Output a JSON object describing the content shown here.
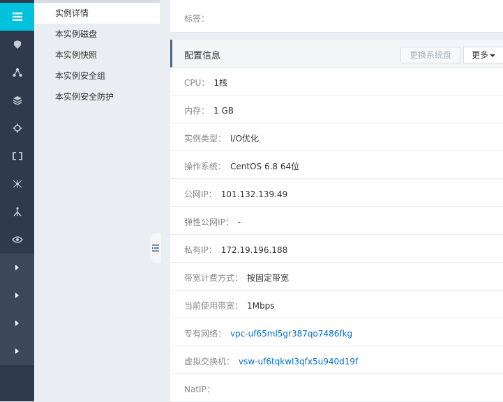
{
  "subnav": {
    "items": [
      {
        "label": "实例详情",
        "active": true
      },
      {
        "label": "本实例磁盘"
      },
      {
        "label": "本实例快照"
      },
      {
        "label": "本实例安全组"
      },
      {
        "label": "本实例安全防护"
      }
    ]
  },
  "tags": {
    "label": "标签："
  },
  "config": {
    "title": "配置信息",
    "change_disk_btn": "更换系统盘",
    "more_btn": "更多",
    "rows": [
      {
        "key": "CPU：",
        "value": "1核"
      },
      {
        "key": "内存：",
        "value": "1 GB"
      },
      {
        "key": "实例类型：",
        "value": "I/O优化"
      },
      {
        "key": "操作系统：",
        "value": "CentOS 6.8 64位"
      },
      {
        "key": "公网IP：",
        "value": "101.132.139.49"
      },
      {
        "key": "弹性公网IP：",
        "value": "-"
      },
      {
        "key": "私有IP：",
        "value": "172.19.196.188"
      },
      {
        "key": "带宽计费方式：",
        "value": "按固定带宽"
      },
      {
        "key": "当前使用带宽：",
        "value": "1Mbps"
      },
      {
        "key": "专有网络：",
        "value": "vpc-uf65ml5gr387qo7486fkg"
      },
      {
        "key": "虚拟交换机：",
        "value": "vsw-uf6tqkwl3qfx5u940d19f"
      },
      {
        "key": "NatIP：",
        "value": ""
      }
    ]
  },
  "colors": {
    "rail": "#2f3b4c",
    "rail_active": "#00c1de",
    "link": "#0070cc"
  },
  "icons": {
    "rail": [
      "menu-icon",
      "ecs-icon",
      "network-icon",
      "database-icon",
      "cog-icon",
      "link-icon",
      "cloud-network-icon",
      "tree-icon",
      "eye-icon",
      "chevron-right-icon",
      "chevron-right-icon",
      "chevron-right-icon",
      "chevron-right-icon"
    ],
    "collapse": "collapse-list-icon"
  }
}
